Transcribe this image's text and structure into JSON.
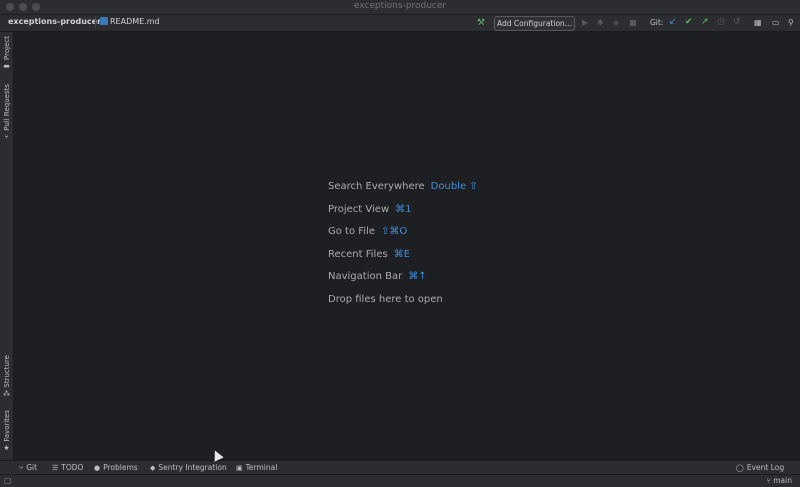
{
  "window": {
    "title": "exceptions-producer"
  },
  "navbar": {
    "project": "exceptions-producer",
    "file": "README.md",
    "add_configuration": "Add Configuration...",
    "git_label": "Git:"
  },
  "left_tabs": [
    {
      "label": "Project"
    },
    {
      "label": "Pull Requests"
    },
    {
      "label": "Structure"
    },
    {
      "label": "Favorites"
    }
  ],
  "hints": [
    {
      "label": "Search Everywhere",
      "shortcut": "Double ⇧"
    },
    {
      "label": "Project View",
      "shortcut": "⌘1"
    },
    {
      "label": "Go to File",
      "shortcut": "⇧⌘O"
    },
    {
      "label": "Recent Files",
      "shortcut": "⌘E"
    },
    {
      "label": "Navigation Bar",
      "shortcut": "⌘↑"
    },
    {
      "label": "Drop files here to open",
      "shortcut": ""
    }
  ],
  "bottom_tabs": [
    {
      "label": "Git",
      "icon": "branch-icon"
    },
    {
      "label": "TODO",
      "icon": "list-icon"
    },
    {
      "label": "Problems",
      "icon": "info-icon"
    },
    {
      "label": "Sentry Integration",
      "icon": "sentry-icon"
    },
    {
      "label": "Terminal",
      "icon": "terminal-icon"
    }
  ],
  "event_log": "Event Log",
  "status": {
    "branch": "main"
  },
  "colors": {
    "accent": "#3d8fe0",
    "run_green": "#5fb85a",
    "bg": "#1e1f22",
    "panel": "#2b2d30"
  }
}
